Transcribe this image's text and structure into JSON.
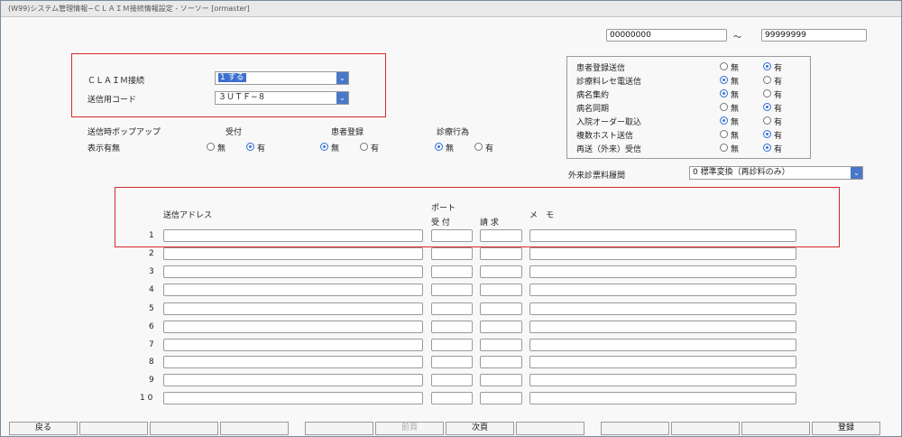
{
  "window": {
    "title": "(W99)システム管理情報−ＣＬＡＩＭ接続情報設定 - ソーソー [ormaster]"
  },
  "range": {
    "from": "00000000",
    "separator": "～",
    "to": "99999999"
  },
  "claim": {
    "connect_label": "ＣＬＡＩＭ接続",
    "connect_value": "1 する",
    "encoding_label": "送信用コード",
    "encoding_value": "３ＵＴＦ−８"
  },
  "popup": {
    "title": "送信時ポップアップ",
    "display_label": "表示有無",
    "columns": [
      {
        "label": "受付",
        "selected": "有"
      },
      {
        "label": "患者登録",
        "selected": "無"
      },
      {
        "label": "診療行為",
        "selected": "無"
      }
    ],
    "option_none": "無",
    "option_yes": "有"
  },
  "send_options": {
    "rows": [
      {
        "label": "患者登録送信",
        "selected": "有"
      },
      {
        "label": "診療料レセ電送信",
        "selected": "無"
      },
      {
        "label": "病名集約",
        "selected": "無"
      },
      {
        "label": "病名同期",
        "selected": "有"
      },
      {
        "label": "入院オーダー取込",
        "selected": "無"
      },
      {
        "label": "複数ホスト送信",
        "selected": "有"
      },
      {
        "label": "再送（外来）受信",
        "selected": "有"
      }
    ],
    "option_none": "無",
    "option_yes": "有"
  },
  "outpatient": {
    "label": "外来診票料履間",
    "value": "0 標準変換（再診料のみ）"
  },
  "hosts": {
    "address_header": "送信アドレス",
    "port_header": "ポート",
    "receive_header": "受 付",
    "request_header": "請 求",
    "memo_header": "メ　モ",
    "rows": [
      "1",
      "2",
      "3",
      "4",
      "5",
      "6",
      "7",
      "8",
      "9",
      "1 0"
    ]
  },
  "footer": {
    "buttons": [
      "戻る",
      "",
      "",
      "",
      "",
      "前頁",
      "次頁",
      "",
      "",
      "",
      "",
      "登録"
    ]
  },
  "colors": {
    "accent": "#3a72d8",
    "highlight": "#d42a2a"
  }
}
